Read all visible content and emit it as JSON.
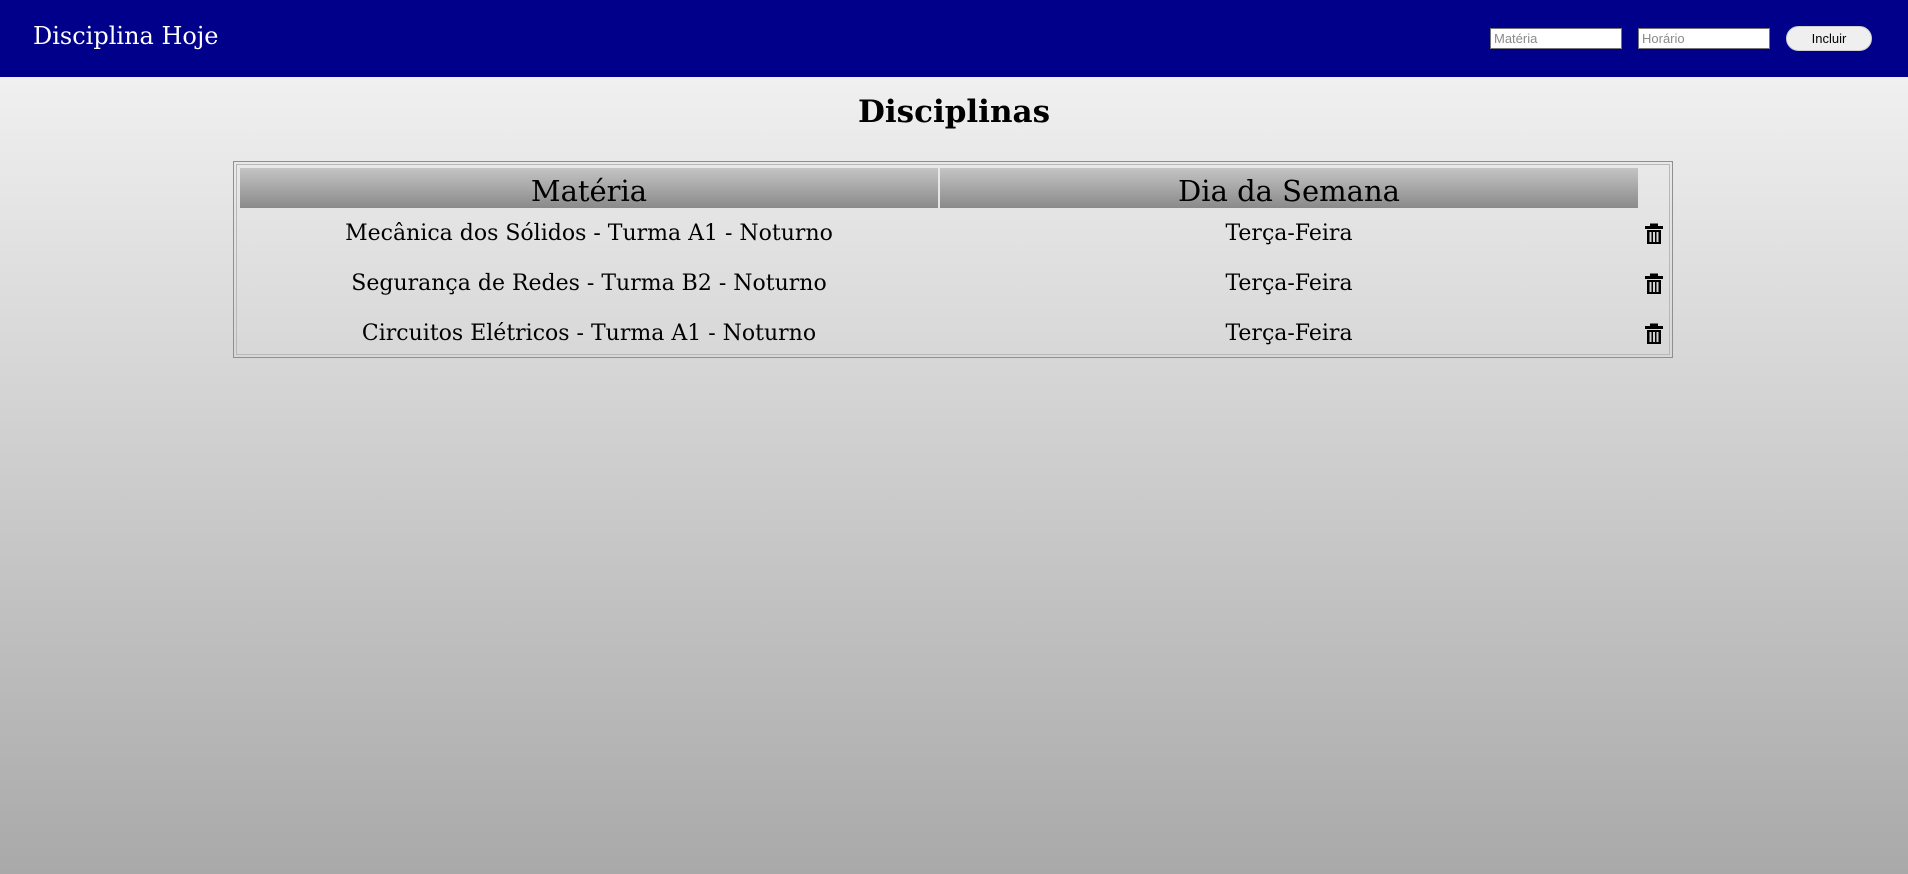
{
  "app": {
    "title": "Disciplina Hoje"
  },
  "form": {
    "materia_placeholder": "Matéria",
    "horario_placeholder": "Horário",
    "materia_value": "",
    "horario_value": "",
    "submit_label": "Incluir"
  },
  "page": {
    "title": "Disciplinas"
  },
  "table": {
    "headers": {
      "materia": "Matéria",
      "dia": "Dia da Semana"
    },
    "rows": [
      {
        "materia": "Mecânica dos Sólidos - Turma A1 - Noturno",
        "dia": "Terça-Feira",
        "action_icon": "trash-icon"
      },
      {
        "materia": "Segurança de Redes - Turma B2 - Noturno",
        "dia": "Terça-Feira",
        "action_icon": "trash-icon"
      },
      {
        "materia": "Circuitos Elétricos - Turma A1 - Noturno",
        "dia": "Terça-Feira",
        "action_icon": "trash-icon"
      }
    ]
  },
  "colors": {
    "header_bg": "#00008b",
    "header_text": "#ffffff",
    "page_gradient_top": "#f7f7f7",
    "page_gradient_bottom": "#a9a9a9"
  }
}
